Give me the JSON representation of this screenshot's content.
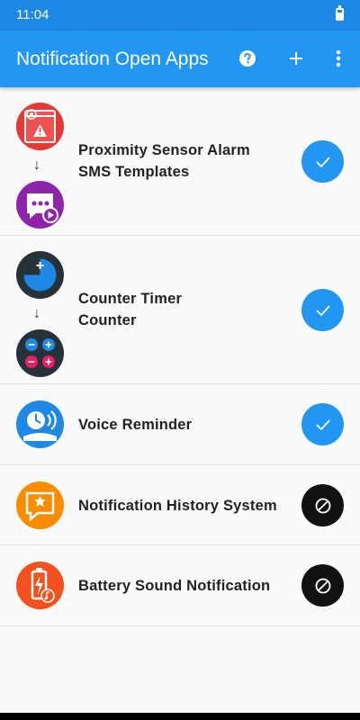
{
  "status_bar": {
    "time": "11:04"
  },
  "app_bar": {
    "title": "Notification Open Apps",
    "help_icon": "help-icon",
    "add_icon": "add-icon",
    "more_icon": "more-vert-icon"
  },
  "rules": [
    {
      "line1": "Proximity Sensor Alarm",
      "line2": "SMS Templates",
      "enabled": true
    },
    {
      "line1": "Counter Timer",
      "line2": "Counter",
      "enabled": true
    },
    {
      "line1": "Voice Reminder",
      "enabled": true
    },
    {
      "line1": "Notification History System",
      "enabled": false
    },
    {
      "line1": "Battery Sound Notification",
      "enabled": false
    }
  ],
  "colors": {
    "accent": "#2196f3",
    "status_bar": "#1e88e5",
    "disabled": "#111111"
  }
}
